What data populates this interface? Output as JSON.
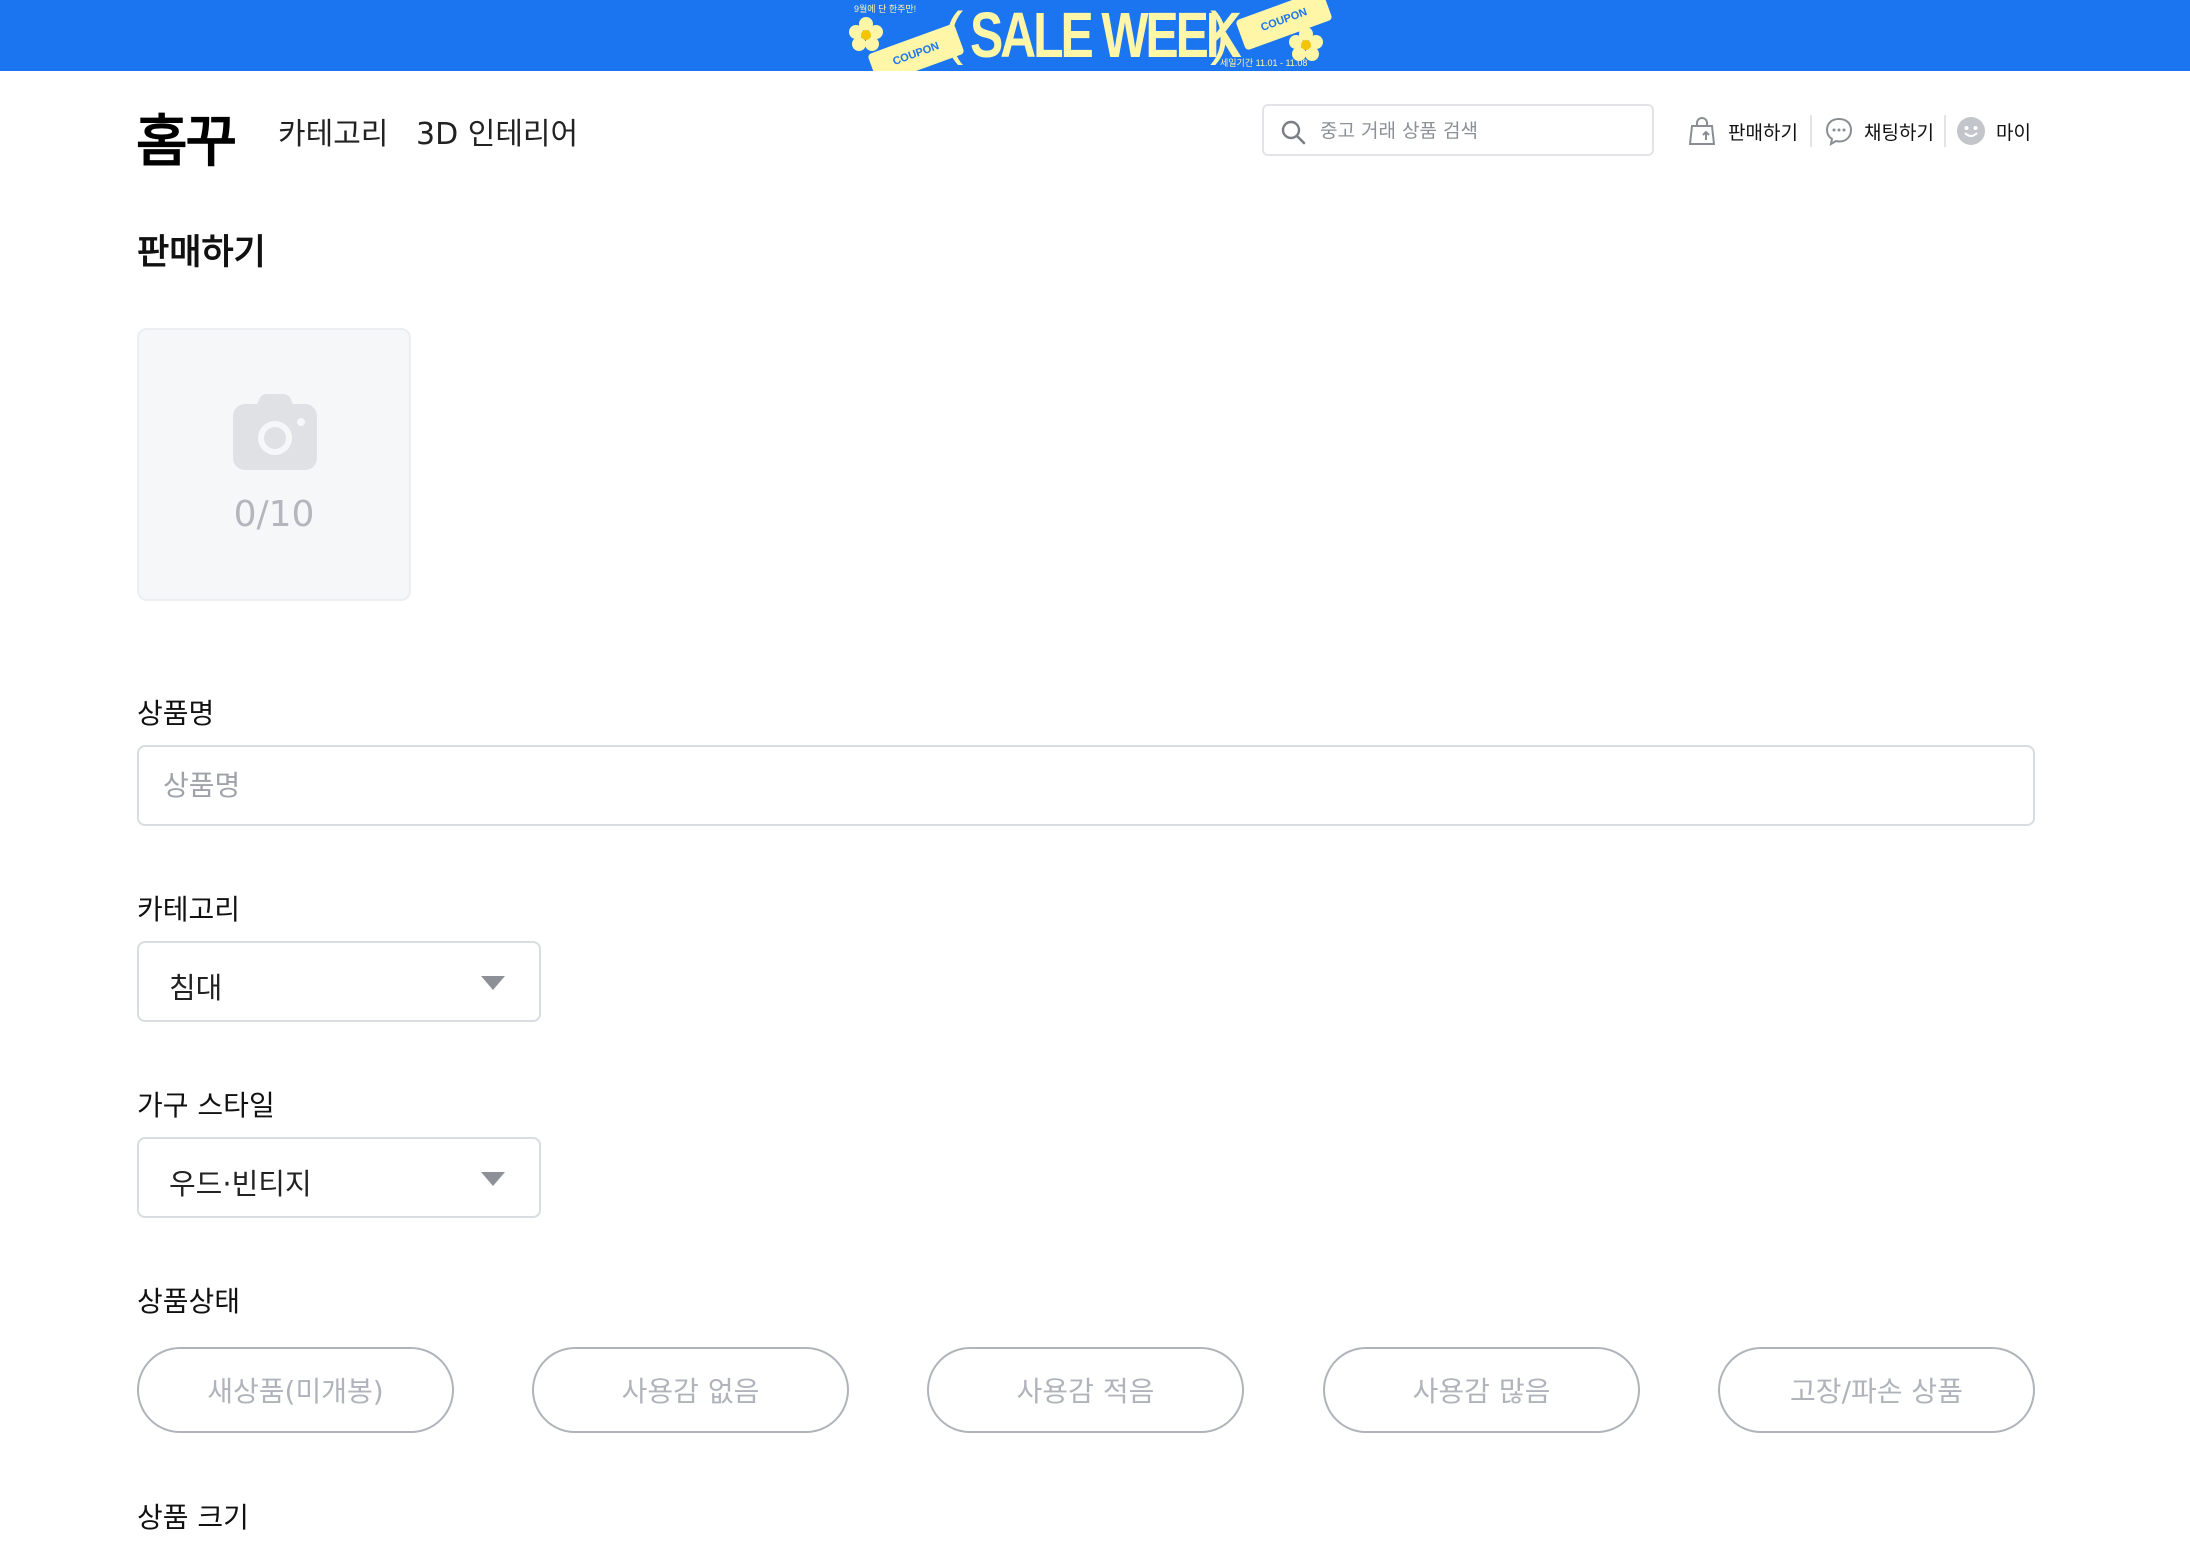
{
  "banner": {
    "headline": "SALE WEEK",
    "paren_left": "(",
    "paren_right": ")",
    "coupon_label": "COUPON",
    "small_top": "9월에 단 한주만!",
    "small_bottom": "세일기간 11.01 - 11.08"
  },
  "header": {
    "logo": "홈꾸",
    "nav": {
      "category": "카테고리",
      "interior3d": "3D 인테리어"
    },
    "search_placeholder": "중고 거래 상품 검색",
    "actions": {
      "sell": "판매하기",
      "chat": "채팅하기",
      "my": "마이"
    }
  },
  "page": {
    "title": "판매하기",
    "upload": {
      "count": "0/10"
    },
    "fields": {
      "name": {
        "label": "상품명",
        "placeholder": "상품명",
        "value": ""
      },
      "category": {
        "label": "카테고리",
        "selected": "침대"
      },
      "style": {
        "label": "가구 스타일",
        "selected": "우드·빈티지"
      },
      "condition": {
        "label": "상품상태",
        "options": [
          "새상품(미개봉)",
          "사용감 없음",
          "사용감 적음",
          "사용감 많음",
          "고장/파손 상품"
        ]
      },
      "size": {
        "label": "상품 크기"
      }
    }
  },
  "colors": {
    "brand_blue": "#1b74f0",
    "banner_text": "#fff6a8",
    "chip_border": "#b0b4ba"
  },
  "icons": [
    "search-icon",
    "shopping-bag-icon",
    "chat-bubble-icon",
    "smiley-avatar-icon",
    "camera-icon",
    "chevron-down-icon"
  ]
}
